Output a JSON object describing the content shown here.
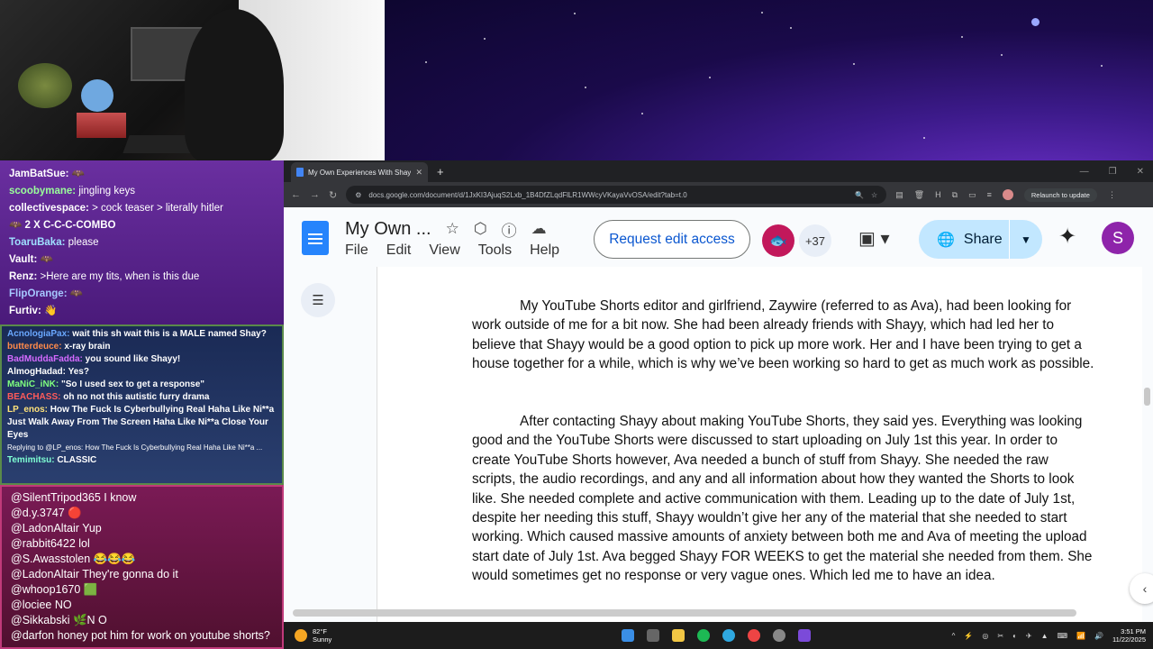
{
  "chat_top": [
    {
      "user": "JamBatSue:",
      "color": "#ffffff",
      "text": ""
    },
    {
      "user": "scoobymane:",
      "color": "#7fff7f",
      "text": "jingling keys"
    },
    {
      "user": "collectivespace:",
      "color": "#ffffff",
      "text": "> cock teaser > literally hitler"
    },
    {
      "user": "",
      "color": "#ffffff",
      "text": "2 X C-C-C-COMBO"
    },
    {
      "user": "ToaruBaka:",
      "color": "#7fd4ff",
      "text": "please"
    },
    {
      "user": "Vault:",
      "color": "#ffffff",
      "text": ""
    },
    {
      "user": "Renz:",
      "color": "#ffffff",
      "text": ">Here are my tits, when is this due"
    },
    {
      "user": "FlipOrange:",
      "color": "#7fb8ff",
      "text": ""
    },
    {
      "user": "Furtiv:",
      "color": "#ffffff",
      "text": ""
    }
  ],
  "chat_mid": [
    {
      "user": "AcnologiaPax:",
      "color": "#6aa8ff",
      "text": "wait this sh wait this is a MALE named Shay?"
    },
    {
      "user": "butterdeuce:",
      "color": "#ff8a4a",
      "text": "x-ray brain"
    },
    {
      "user": "BadMuddaFadda:",
      "color": "#d56aff",
      "text": "you sound like Shayy!"
    },
    {
      "user": "AlmogHadad:",
      "color": "#ffffff",
      "text": "Yes?"
    },
    {
      "user": "MaNiC_iNK:",
      "color": "#7fff7f",
      "text": "\"So I used sex to get a response\""
    },
    {
      "user": "BEACHASS:",
      "color": "#ff5a5a",
      "text": "oh no not this autistic furry drama"
    },
    {
      "user": "LP_enos:",
      "color": "#ffe27a",
      "text": "How The Fuck Is Cyberbullying Real Haha Like Ni**a Just Walk Away From The Screen Haha Like Ni**a Close Your Eyes"
    },
    {
      "user": "",
      "color": "#ffffff",
      "text": "Replying to @LP_enos: How The Fuck Is Cyberbullying Real Haha Like Ni**a ..."
    },
    {
      "user": "Temimitsu:",
      "color": "#7fffd4",
      "text": "CLASSIC"
    }
  ],
  "chat_bottom": [
    {
      "user": "@SilentTripod365",
      "text": "I know"
    },
    {
      "user": "@d.y.3747",
      "text": ""
    },
    {
      "user": "@LadonAltair",
      "text": "Yup"
    },
    {
      "user": "@rabbit6422",
      "text": "lol"
    },
    {
      "user": "@S.Awasstolen",
      "text": ""
    },
    {
      "user": "@LadonAltair",
      "text": "They're gonna do it"
    },
    {
      "user": "@whoop1670",
      "text": ""
    },
    {
      "user": "@lociee",
      "text": "NO"
    },
    {
      "user": "@Sikkabski",
      "text": "N O"
    },
    {
      "user": "@darfon",
      "text": "honey pot him for work on youtube shorts?"
    }
  ],
  "browser": {
    "tab_title": "My Own Experiences With Shayy",
    "url": "docs.google.com/document/d/1JxKI3AjuqS2Lxb_1B4DfZLqdFlLR1WWcyVKayaVvOSA/edit?tab=t.0",
    "relaunch": "Relaunch to update"
  },
  "docs": {
    "title": "My Own ...",
    "menu": [
      "File",
      "Edit",
      "View",
      "Tools",
      "Help"
    ],
    "request_edit": "Request edit access",
    "collab_count": "+37",
    "share": "Share",
    "user_initial": "S",
    "paragraphs": [
      "My YouTube Shorts editor and girlfriend, Zaywire (referred to as Ava), had been looking for work outside of me for a bit now. She had been already friends with Shayy, which had led her to believe that Shayy would be a good option to pick up more work. Her and I have been trying to get a house together for a while, which is why we’ve been working so hard to get as much work as possible.",
      "After contacting Shayy about making YouTube Shorts, they said yes. Everything was looking good and the YouTube Shorts were discussed to start uploading on July 1st this year. In order to create YouTube Shorts however, Ava needed a bunch of stuff from Shayy. She needed the raw scripts, the audio recordings, and any and all information about how they wanted the Shorts to look like. She needed complete and active communication with them. Leading up to the date of July 1st, despite her needing this stuff, Shayy wouldn’t give her any of the material that she needed to start working. Which caused massive amounts of anxiety between both me and Ava of meeting the upload start date of July 1st. Ava begged Shayy FOR WEEKS to get the material she needed from them. She would sometimes get no response or very vague ones. Which led me to have an idea."
    ]
  },
  "taskbar": {
    "temp": "82°F",
    "condition": "Sunny",
    "time": "3:51 PM",
    "date": "11/22/2025"
  }
}
